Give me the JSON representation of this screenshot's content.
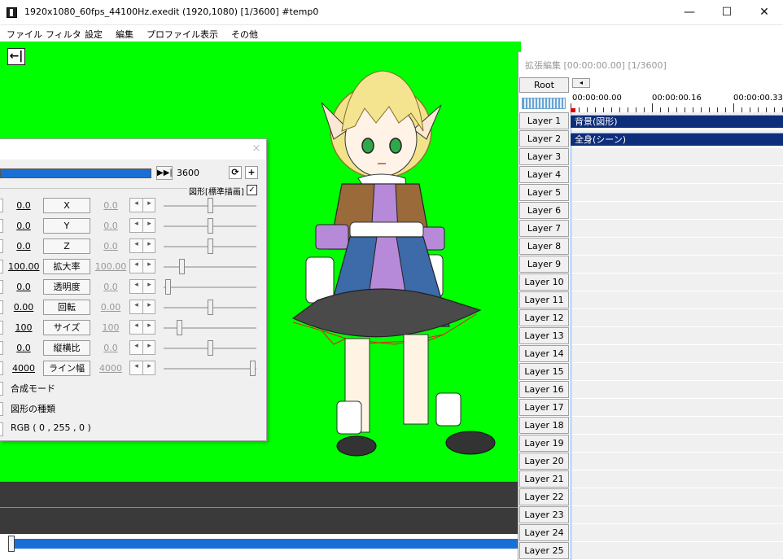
{
  "window": {
    "title": "1920x1080_60fps_44100Hz.exedit (1920,1080)  [1/3600]  #temp0",
    "minimize": "—",
    "maximize": "☐",
    "close": "✕"
  },
  "menu": [
    "ファイル",
    "フィルタ",
    "設定",
    "編集",
    "プロファイル",
    "表示",
    "その他"
  ],
  "canvas": {
    "background_color": "#00ff00",
    "back_icon": "←|"
  },
  "dialog": {
    "close": "×",
    "end_icon": "▶▶|",
    "frame_end": "3600",
    "draw_label": "図形[標準描画]",
    "draw_checked": "✓",
    "loop_icon": "⟳",
    "add_icon": "+",
    "params": [
      {
        "name": "X",
        "value": "0.0",
        "value2": "0.0",
        "level": 0.5
      },
      {
        "name": "Y",
        "value": "0.0",
        "value2": "0.0",
        "level": 0.5
      },
      {
        "name": "Z",
        "value": "0.0",
        "value2": "0.0",
        "level": 0.5
      },
      {
        "name": "拡大率",
        "value": "100.00",
        "value2": "100.00",
        "level": 0.16
      },
      {
        "name": "透明度",
        "value": "0.0",
        "value2": "0.0",
        "level": 0.0
      },
      {
        "name": "回転",
        "value": "0.00",
        "value2": "0.00",
        "level": 0.5
      },
      {
        "name": "サイズ",
        "value": "100",
        "value2": "100",
        "level": 0.13
      },
      {
        "name": "縦横比",
        "value": "0.0",
        "value2": "0.0",
        "level": 0.5
      },
      {
        "name": "ライン幅",
        "value": "4000",
        "value2": "4000",
        "level": 1.0
      }
    ],
    "arrow_left": "◂",
    "arrow_right": "▸",
    "blend_mode": "合成モード",
    "shape_type": "図形の種類",
    "color": "RGB ( 0 , 255 , 0 )"
  },
  "extended_edit": {
    "title": "拡張編集 [00:00:00.00] [1/3600]",
    "root": "Root",
    "scroll_left": "◂",
    "times": [
      "00:00:00.00",
      "00:00:00.16",
      "00:00:00.33"
    ],
    "layers": [
      "Layer 1",
      "Layer 2",
      "Layer 3",
      "Layer 4",
      "Layer 5",
      "Layer 6",
      "Layer 7",
      "Layer 8",
      "Layer 9",
      "Layer 10",
      "Layer 11",
      "Layer 12",
      "Layer 13",
      "Layer 14",
      "Layer 15",
      "Layer 16",
      "Layer 17",
      "Layer 18",
      "Layer 19",
      "Layer 20",
      "Layer 21",
      "Layer 22",
      "Layer 23",
      "Layer 24",
      "Layer 25"
    ],
    "clips": [
      {
        "layer": 1,
        "label": "背景(図形)"
      },
      {
        "layer": 2,
        "label": "全身(シーン)"
      }
    ]
  }
}
